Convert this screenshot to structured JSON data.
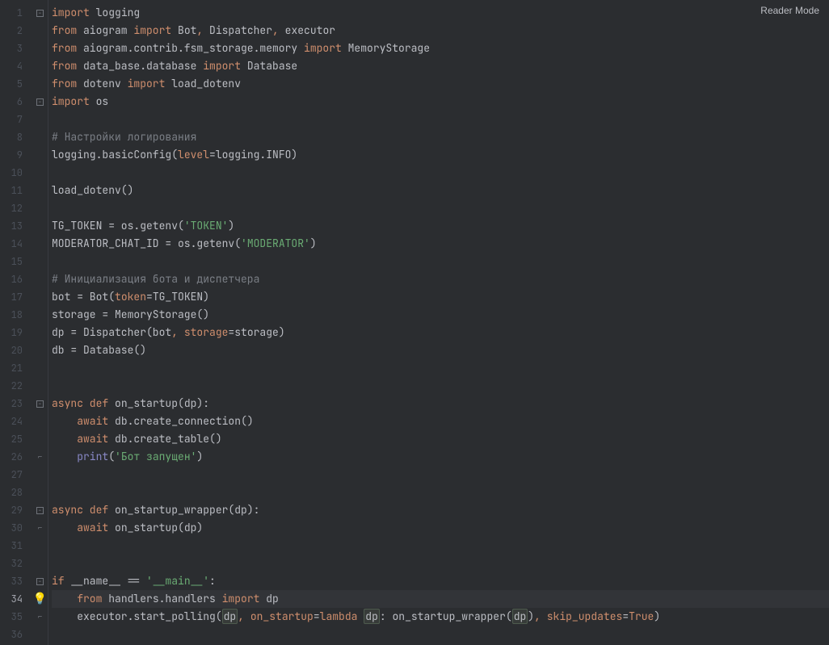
{
  "header": {
    "reader_mode": "Reader Mode"
  },
  "gutter": {
    "current_line": 34,
    "run_line": 33,
    "bulb_line": 34,
    "lines": [
      1,
      2,
      3,
      4,
      5,
      6,
      7,
      8,
      9,
      10,
      11,
      12,
      13,
      14,
      15,
      16,
      17,
      18,
      19,
      20,
      21,
      22,
      23,
      24,
      25,
      26,
      27,
      28,
      29,
      30,
      31,
      32,
      33,
      34,
      35,
      36
    ]
  },
  "fold_markers": {
    "1": "open",
    "6": "close",
    "23": "open",
    "26": "close",
    "29": "open",
    "30": "close",
    "33": "open",
    "35": "close"
  },
  "code": {
    "l1": {
      "a": "import",
      "b": " logging"
    },
    "l2": {
      "a": "from",
      "b": " aiogram ",
      "c": "import",
      "d": " Bot",
      "e": ", ",
      "f": "Dispatcher",
      "g": ", ",
      "h": "executor"
    },
    "l3": {
      "a": "from",
      "b": " aiogram.contrib.fsm_storage.memory ",
      "c": "import",
      "d": " MemoryStorage"
    },
    "l4": {
      "a": "from",
      "b": " data_base.database ",
      "c": "import",
      "d": " Database"
    },
    "l5": {
      "a": "from",
      "b": " dotenv ",
      "c": "import",
      "d": " load_dotenv"
    },
    "l6": {
      "a": "import",
      "b": " os"
    },
    "l8": {
      "a": "# Настройки логирования"
    },
    "l9": {
      "a": "logging.basicConfig(",
      "b": "level",
      "c": "=logging.INFO)"
    },
    "l11": {
      "a": "load_dotenv()"
    },
    "l13": {
      "a": "TG_TOKEN = os.getenv(",
      "b": "'TOKEN'",
      "c": ")"
    },
    "l14": {
      "a": "MODERATOR_CHAT_ID = os.getenv(",
      "b": "'MODERATOR'",
      "c": ")"
    },
    "l16": {
      "a": "# Инициализация бота и диспетчера"
    },
    "l17": {
      "a": "bot = Bot(",
      "b": "token",
      "c": "=TG_TOKEN)"
    },
    "l18": {
      "a": "storage = MemoryStorage()"
    },
    "l19": {
      "a": "dp = Dispatcher(bot",
      "b": ", ",
      "c": "storage",
      "d": "=storage)"
    },
    "l20": {
      "a": "db = Database()"
    },
    "l23": {
      "a": "async def ",
      "b": "on_startup",
      "c": "(dp):"
    },
    "l24": {
      "a": "    ",
      "b": "await ",
      "c": "db.create_connection()"
    },
    "l25": {
      "a": "    ",
      "b": "await ",
      "c": "db.create_table()"
    },
    "l26": {
      "a": "    ",
      "b": "print",
      "c": "(",
      "d": "'Бот запущен'",
      "e": ")"
    },
    "l29": {
      "a": "async def ",
      "b": "on_startup_wrapper",
      "c": "(dp):"
    },
    "l30": {
      "a": "    ",
      "b": "await ",
      "c": "on_startup(dp)"
    },
    "l33": {
      "a": "if ",
      "b": "__name__ == ",
      "c": "'__main__'",
      "d": ":"
    },
    "l34": {
      "a": "    ",
      "b": "from ",
      "c": "handlers.handlers ",
      "d": "import ",
      "e": "dp"
    },
    "l35": {
      "a": "    executor.start_polling(",
      "b": "dp",
      "c": ", ",
      "d": "on_startup",
      "e": "=",
      "f": "lambda ",
      "g": "dp",
      "h": ": on_startup_wrapper(",
      "i": "dp",
      "j": ")",
      "k": ", ",
      "l": "skip_updates",
      "m": "=",
      "n": "True",
      "o": ")"
    }
  }
}
